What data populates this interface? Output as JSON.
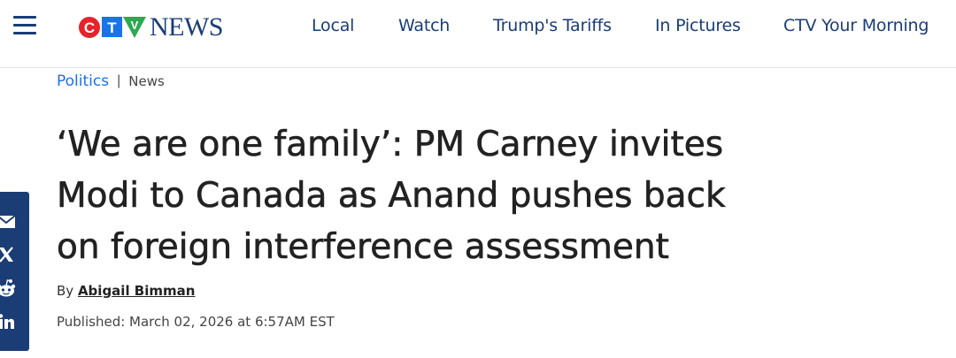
{
  "logo": {
    "letters": [
      "C",
      "T",
      "V"
    ],
    "letter_colors": [
      "#e8212b",
      "#1a73e8",
      "#2fa84f"
    ],
    "word": "NEWS",
    "word_color": "#1a3d75"
  },
  "nav": {
    "items": [
      {
        "label": "Local"
      },
      {
        "label": "Watch"
      },
      {
        "label": "Trump's Tariffs"
      },
      {
        "label": "In Pictures"
      },
      {
        "label": "CTV Your Morning"
      }
    ]
  },
  "breadcrumb": {
    "primary": "Politics",
    "separator": "|",
    "secondary": "News"
  },
  "article": {
    "headline_lines": [
      "‘We are one family’: PM Carney invites",
      "Modi to Canada as Anand pushes back",
      "on foreign interference assessment"
    ],
    "byline_prefix": "By",
    "author": "Abigail Bimman",
    "published": "Published: March 02, 2026 at 6:57AM EST"
  },
  "share": {
    "icons": [
      "email-icon",
      "x-icon",
      "reddit-icon",
      "linkedin-icon"
    ]
  },
  "colors": {
    "brand_navy": "#1a3d75",
    "link_blue": "#1a73e8",
    "text_dark": "#222222"
  }
}
